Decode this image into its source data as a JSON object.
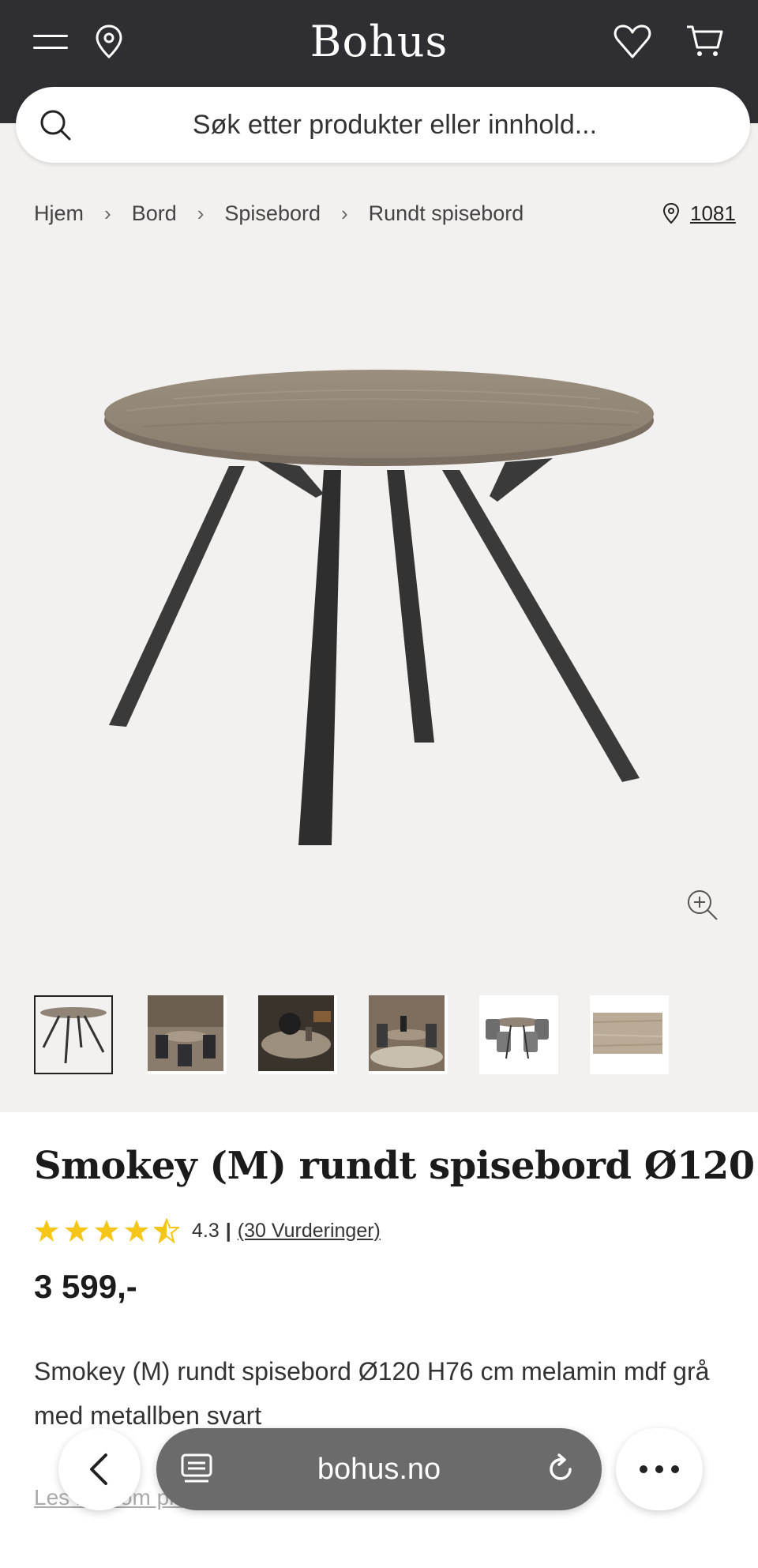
{
  "header": {
    "logo": "Bohus",
    "search_placeholder": "Søk etter produkter eller innhold..."
  },
  "breadcrumb": [
    "Hjem",
    "Bord",
    "Spisebord",
    "Rundt spisebord"
  ],
  "store": {
    "label": "1081"
  },
  "product": {
    "title": "Smokey (M) rundt spisebord Ø120",
    "rating_value": "4.3",
    "rating_fraction": 0.86,
    "reviews_link": "(30 Vurderinger)",
    "price": "3 599,-",
    "description": "Smokey (M) rundt spisebord Ø120 H76 cm melamin mdf grå med metallben svart",
    "read_more": "Les mer om produktet"
  },
  "browser": {
    "url": "bohus.no"
  },
  "colors": {
    "header_bg": "#2f2f33",
    "gallery_bg": "#f3f1ef",
    "star": "#f5c518"
  },
  "icons": [
    "menu-icon",
    "location-pin-icon",
    "heart-icon",
    "cart-icon",
    "search-icon",
    "zoom-in-icon",
    "back-arrow-icon",
    "tabs-icon",
    "reload-icon",
    "more-icon"
  ]
}
